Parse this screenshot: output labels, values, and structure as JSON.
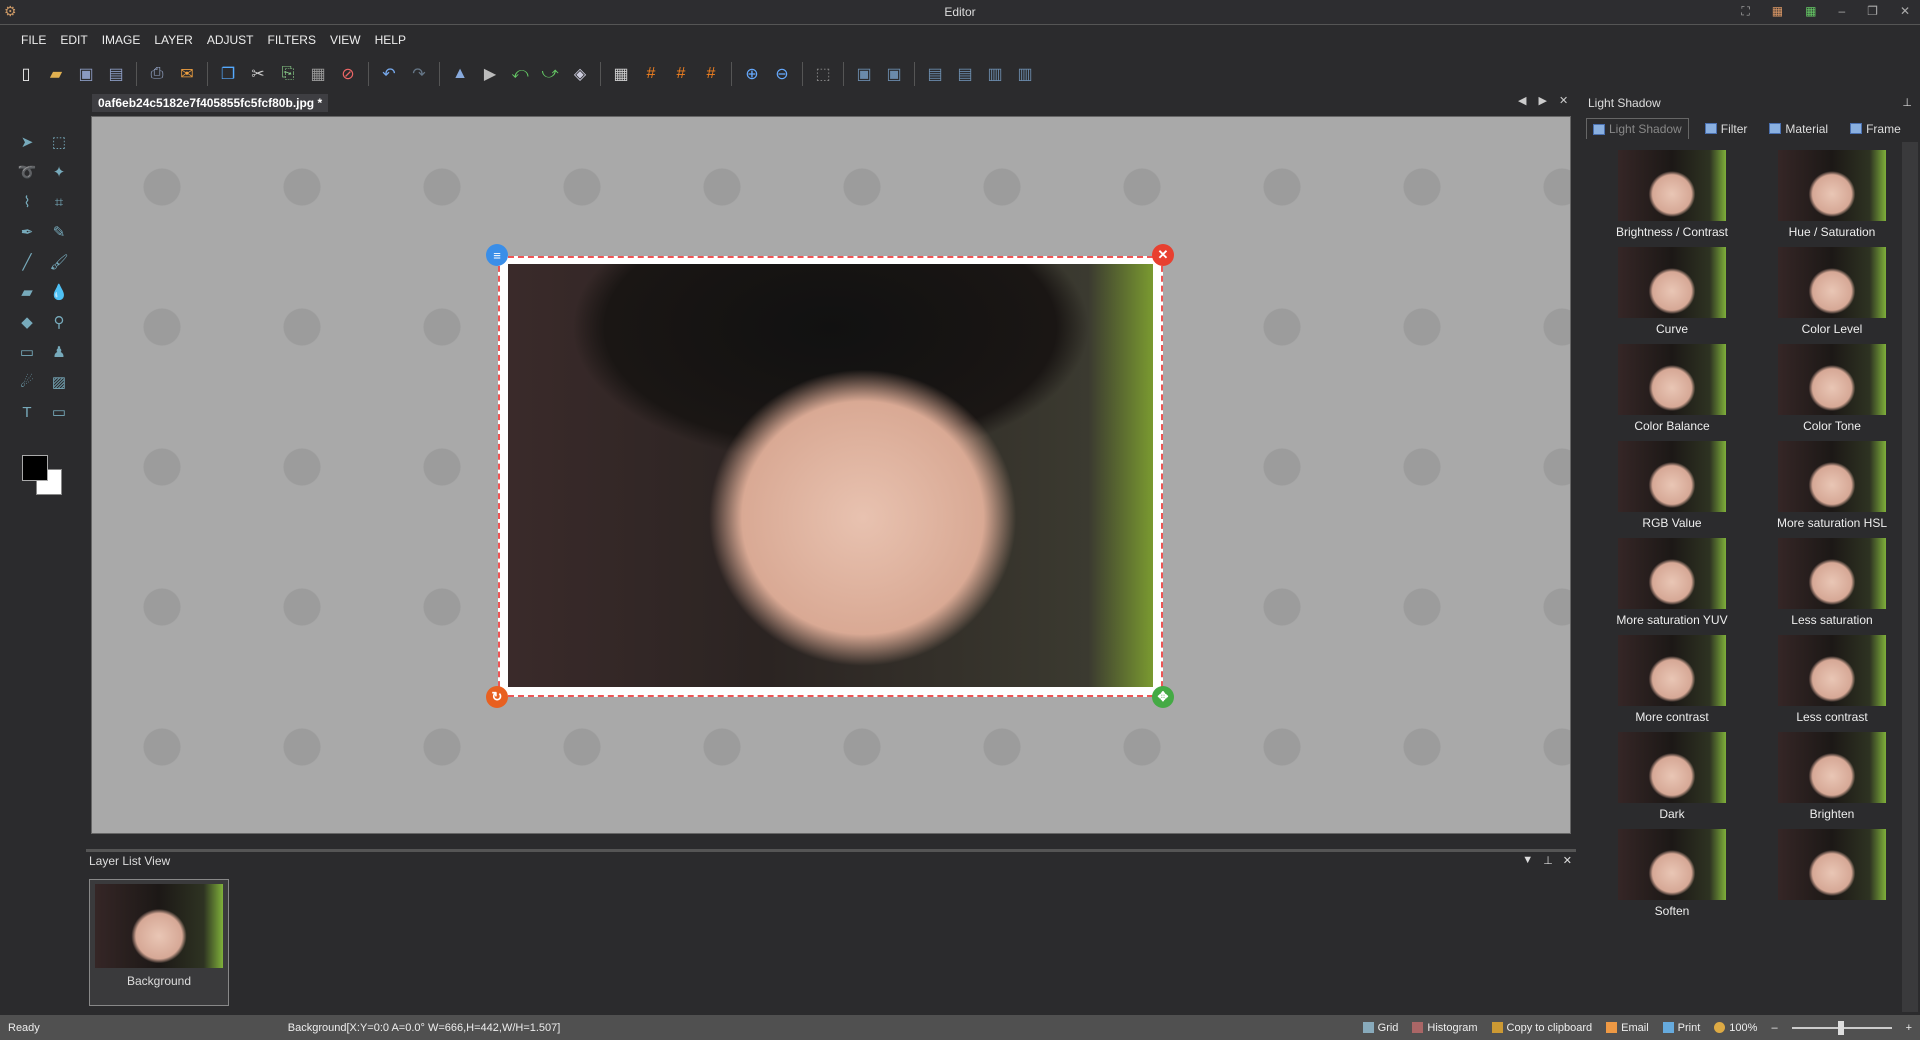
{
  "window": {
    "title": "Editor"
  },
  "menu": [
    "FILE",
    "EDIT",
    "IMAGE",
    "LAYER",
    "ADJUST",
    "FILTERS",
    "VIEW",
    "HELP"
  ],
  "toolbar": [
    {
      "icon": "new-file-icon",
      "g": "▯",
      "c": "#eee"
    },
    {
      "icon": "open-folder-icon",
      "g": "▰",
      "c": "#e0b050"
    },
    {
      "icon": "save-icon",
      "g": "▣",
      "c": "#8a9ac0"
    },
    {
      "icon": "save-as-icon",
      "g": "▤",
      "c": "#8a9ac0"
    },
    null,
    {
      "icon": "print-icon",
      "g": "⎙",
      "c": "#9ac"
    },
    {
      "icon": "email-icon",
      "g": "✉",
      "c": "#f0a040"
    },
    null,
    {
      "icon": "copy-window-icon",
      "g": "❐",
      "c": "#5af"
    },
    {
      "icon": "cut-icon",
      "g": "✂",
      "c": "#ccc"
    },
    {
      "icon": "paste-icon",
      "g": "⎘",
      "c": "#8c8"
    },
    {
      "icon": "clipboard-icon",
      "g": "▦",
      "c": "#999"
    },
    {
      "icon": "delete-icon",
      "g": "⊘",
      "c": "#e66"
    },
    null,
    {
      "icon": "undo-icon",
      "g": "↶",
      "c": "#7ae"
    },
    {
      "icon": "redo-icon",
      "g": "↷",
      "c": "#678"
    },
    null,
    {
      "icon": "flip-vertical-icon",
      "g": "▲",
      "c": "#8ad"
    },
    {
      "icon": "flip-horizontal-icon",
      "g": "▶",
      "c": "#bbb"
    },
    {
      "icon": "rotate-left-icon",
      "g": "⤺",
      "c": "#6c6"
    },
    {
      "icon": "rotate-right-icon",
      "g": "⤻",
      "c": "#6c6"
    },
    {
      "icon": "transform-icon",
      "g": "◈",
      "c": "#ccd"
    },
    null,
    {
      "icon": "perspective-grid-icon",
      "g": "▦",
      "c": "#ccc"
    },
    {
      "icon": "grid-icon",
      "g": "#",
      "c": "#f08020"
    },
    {
      "icon": "grid-alt-icon",
      "g": "#",
      "c": "#f08020"
    },
    {
      "icon": "grid-fine-icon",
      "g": "#",
      "c": "#f08020"
    },
    null,
    {
      "icon": "zoom-in-icon",
      "g": "⊕",
      "c": "#6af"
    },
    {
      "icon": "zoom-out-icon",
      "g": "⊖",
      "c": "#6af"
    },
    null,
    {
      "icon": "select-pointer-icon",
      "g": "⬚",
      "c": "#888"
    },
    null,
    {
      "icon": "fit-icon",
      "g": "▣",
      "c": "#6a8aaa"
    },
    {
      "icon": "actual-size-icon",
      "g": "▣",
      "c": "#6a8aaa"
    },
    null,
    {
      "icon": "align-left-icon",
      "g": "▤",
      "c": "#6a8aaa"
    },
    {
      "icon": "align-right-icon",
      "g": "▤",
      "c": "#6a8aaa"
    },
    {
      "icon": "align-top-icon",
      "g": "▥",
      "c": "#6a8aaa"
    },
    {
      "icon": "align-bottom-icon",
      "g": "▥",
      "c": "#6a8aaa"
    }
  ],
  "document": {
    "tab": "0af6eb24c5182e7f405855fc5fcf80b.jpg *"
  },
  "tools": [
    "select-arrow-icon",
    "rect-select-icon",
    "lasso-icon",
    "magic-wand-icon",
    "polygon-lasso-icon",
    "crop-icon",
    "pen-icon",
    "pencil-icon",
    "line-icon",
    "brush-icon",
    "eraser-icon",
    "blur-drop-icon",
    "fill-bucket-icon",
    "color-picker-icon",
    "gradient-icon",
    "stamp-icon",
    "smudge-icon",
    "image-icon",
    "text-icon",
    "shape-rect-icon"
  ],
  "right_panel": {
    "title": "Light Shadow",
    "tabs": [
      "Light Shadow",
      "Filter",
      "Material",
      "Frame"
    ],
    "effects": [
      "Brightness / Contrast",
      "Hue / Saturation",
      "Curve",
      "Color Level",
      "Color Balance",
      "Color Tone",
      "RGB Value",
      "More saturation HSL",
      "More saturation YUV",
      "Less saturation",
      "More contrast",
      "Less contrast",
      "Dark",
      "Brighten",
      "Soften",
      ""
    ]
  },
  "layer_view": {
    "title": "Layer List View",
    "layers": [
      {
        "name": "Background"
      }
    ]
  },
  "status": {
    "left": "Ready",
    "info": "Background[X:Y=0:0 A=0.0° W=666,H=442,W/H=1.507]",
    "grid": "Grid",
    "histogram": "Histogram",
    "copy": "Copy to clipboard",
    "email": "Email",
    "print": "Print",
    "zoom": "100%"
  },
  "colors": {
    "accent_red": "#e84030",
    "handle_blue": "#3a8ee8",
    "foreground": "#000000",
    "background": "#ffffff"
  }
}
